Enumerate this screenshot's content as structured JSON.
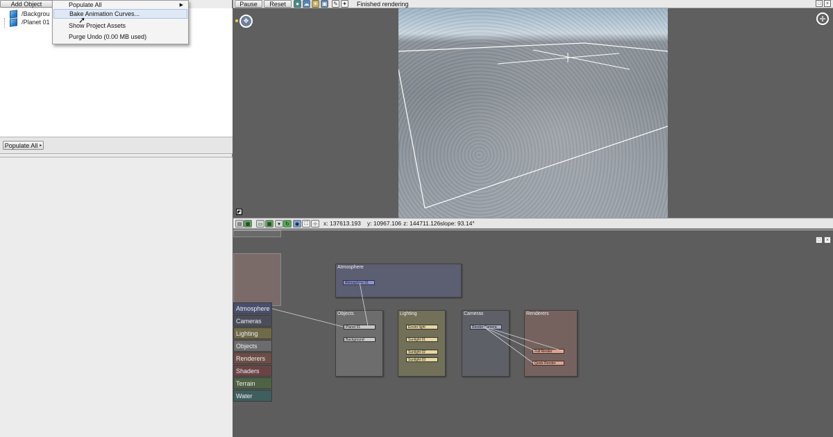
{
  "left_panel": {
    "add_object_label": "Add Object",
    "tree_items": [
      "/Backgrou",
      "/Planet 01"
    ],
    "populate_all_label": "Populate All"
  },
  "context_menu": {
    "items": [
      {
        "label": "Populate All",
        "has_submenu": true
      },
      {
        "label": "Bake Animation Curves...",
        "highlighted": true
      },
      {
        "label": "Show Project Assets"
      },
      {
        "label": "Purge Undo (0.00 MB used)"
      }
    ]
  },
  "toolbar": {
    "pause_label": "Pause",
    "reset_label": "Reset",
    "status": "Finished rendering",
    "icons": [
      "sphere-icon",
      "cloud-icon",
      "light-icon",
      "camera-icon",
      "brush-icon",
      "lamp-icon"
    ]
  },
  "viewport": {
    "icons": [
      "navigate-icon",
      "compass-icon",
      "viewport-mode-icon"
    ]
  },
  "coord_bar": {
    "x": "x: 137613.193",
    "y": "y: 10967.106",
    "z": "z: 144711.126",
    "slope": "slope: 93.14°"
  },
  "node_editor": {
    "categories": [
      {
        "label": "Atmosphere",
        "color": "#48506e"
      },
      {
        "label": "Cameras",
        "color": "#4a4e5a"
      },
      {
        "label": "Lighting",
        "color": "#6f6a48"
      },
      {
        "label": "Objects",
        "color": "#6c6c6c"
      },
      {
        "label": "Renderers",
        "color": "#6c4e46"
      },
      {
        "label": "Shaders",
        "color": "#6a4444"
      },
      {
        "label": "Terrain",
        "color": "#4e6244"
      },
      {
        "label": "Water",
        "color": "#3f5e5e"
      }
    ],
    "groups": {
      "atmosphere": {
        "title": "Atmosphere",
        "nodes": [
          "Atmosphere 01"
        ]
      },
      "objects": {
        "title": "Objects",
        "nodes": [
          "Planet 01",
          "Background"
        ]
      },
      "lighting": {
        "title": "Lighting",
        "nodes": [
          "Enviro light",
          "Sunlight 01",
          "Sunlight 02",
          "Sunlight 03"
        ]
      },
      "cameras": {
        "title": "Cameras",
        "nodes": [
          "Render Camera"
        ]
      },
      "renderers": {
        "title": "Renderers",
        "nodes": [
          "Full Render",
          "Quick Render"
        ]
      }
    }
  }
}
